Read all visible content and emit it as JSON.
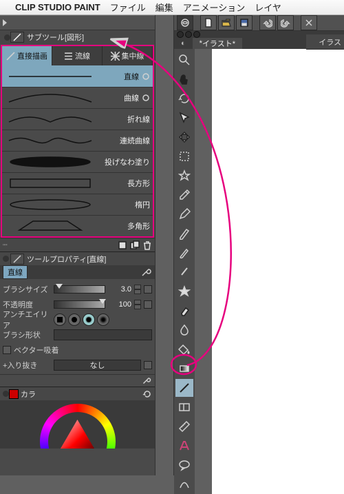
{
  "menubar": {
    "app": "CLIP STUDIO PAINT",
    "items": [
      "ファイル",
      "編集",
      "アニメーション",
      "レイヤ"
    ]
  },
  "subtool": {
    "title": "サブツール[図形]",
    "tabs": [
      {
        "id": "direct",
        "label": "直接描画",
        "active": true
      },
      {
        "id": "stream",
        "label": "流線"
      },
      {
        "id": "focus",
        "label": "集中線"
      }
    ],
    "tools": [
      {
        "id": "line",
        "label": "直線",
        "active": true
      },
      {
        "id": "curve",
        "label": "曲線"
      },
      {
        "id": "polyline",
        "label": "折れ線"
      },
      {
        "id": "contcurve",
        "label": "連続曲線"
      },
      {
        "id": "lasso",
        "label": "投げなわ塗り"
      },
      {
        "id": "rect",
        "label": "長方形"
      },
      {
        "id": "ellipse",
        "label": "楕円"
      },
      {
        "id": "polygon",
        "label": "多角形"
      }
    ]
  },
  "toolprop": {
    "title": "ツールプロパティ[直線]",
    "name": "直線",
    "brush_size_label": "ブラシサイズ",
    "brush_size": "3.0",
    "opacity_label": "不透明度",
    "opacity": "100",
    "aa_label": "アンチエイリア",
    "shape_label": "ブラシ形状",
    "vector_label": "ベクター吸着",
    "inout_label": "+入り抜き",
    "inout_value": "なし"
  },
  "color": {
    "title": "カラ"
  },
  "doc": {
    "tag": "イラス",
    "tab": "イラスト*"
  }
}
